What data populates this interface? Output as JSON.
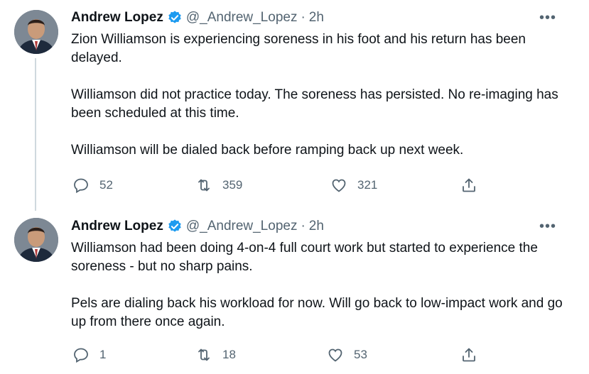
{
  "tweets": [
    {
      "author": {
        "name": "Andrew Lopez",
        "handle": "@_Andrew_Lopez",
        "separator": "·",
        "time": "2h"
      },
      "paragraphs": [
        "Zion Williamson is experiencing soreness in his foot and his return has been delayed.",
        "Williamson did not practice today. The soreness has persisted. No re-imaging has been scheduled at this time.",
        "Williamson will be dialed back before ramping back up next week."
      ],
      "stats": {
        "replies": "52",
        "retweets": "359",
        "likes": "321"
      },
      "more_label": "•••"
    },
    {
      "author": {
        "name": "Andrew Lopez",
        "handle": "@_Andrew_Lopez",
        "separator": "·",
        "time": "2h"
      },
      "paragraphs": [
        "Williamson had been doing 4-on-4 full court work but started to experience the soreness - but no sharp pains.",
        "Pels are dialing back his workload for now. Will go back to low-impact work and go up from there once again."
      ],
      "stats": {
        "replies": "1",
        "retweets": "18",
        "likes": "53"
      },
      "more_label": "•••"
    }
  ],
  "colors": {
    "verified": "#1d9bf0",
    "secondary_text": "#536471",
    "thread_line": "#cfd9de"
  },
  "icons": [
    "verified-badge-icon",
    "reply-icon",
    "retweet-icon",
    "like-icon",
    "share-icon",
    "more-icon"
  ]
}
